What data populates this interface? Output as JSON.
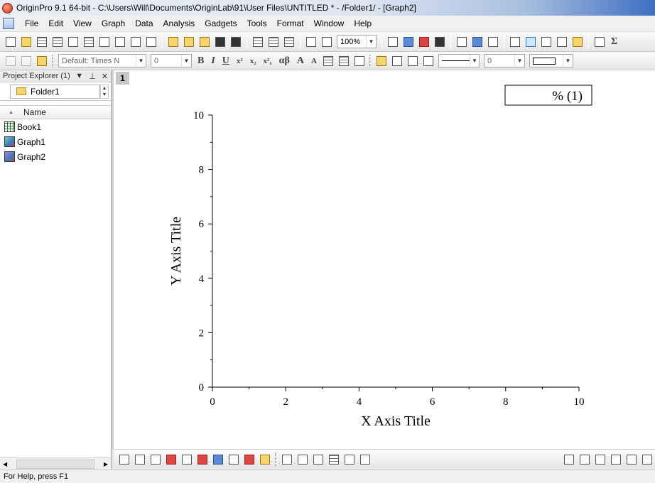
{
  "window": {
    "title": "OriginPro 9.1 64-bit - C:\\Users\\Will\\Documents\\OriginLab\\91\\User Files\\UNTITLED * - /Folder1/ - [Graph2]"
  },
  "menu": [
    "File",
    "Edit",
    "View",
    "Graph",
    "Data",
    "Analysis",
    "Gadgets",
    "Tools",
    "Format",
    "Window",
    "Help"
  ],
  "toolbar": {
    "zoom": "100%",
    "font": "Default: Times N",
    "font_size": "0",
    "text_buttons": [
      "B",
      "I",
      "U",
      "x²",
      "x₂",
      "x²₁",
      "αβ",
      "A",
      "A"
    ],
    "line_width": "0"
  },
  "explorer": {
    "title": "Project Explorer (1)",
    "folder": "Folder1",
    "column": "Name",
    "items": [
      "Book1",
      "Graph1",
      "Graph2"
    ]
  },
  "graph": {
    "layer": "1",
    "legend": "% (1)"
  },
  "chart_data": {
    "type": "line",
    "title": "",
    "xlabel": "X Axis Title",
    "ylabel": "Y Axis Title",
    "xlim": [
      0,
      10
    ],
    "ylim": [
      0,
      10
    ],
    "x_ticks": [
      "0",
      "2",
      "4",
      "6",
      "8",
      "10"
    ],
    "y_ticks": [
      "0",
      "2",
      "4",
      "6",
      "8",
      "10"
    ],
    "series": [],
    "grid": false,
    "legend_position": "top-right"
  },
  "status": {
    "text": "For Help, press F1"
  }
}
